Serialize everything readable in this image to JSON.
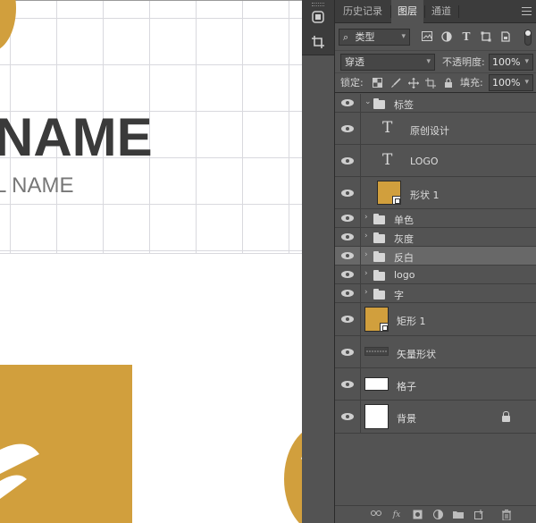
{
  "canvas": {
    "big_name": "NAME",
    "sub_name": "L NAME"
  },
  "panel": {
    "tabs": [
      {
        "label": "历史记录",
        "active": false
      },
      {
        "label": "图层",
        "active": true
      },
      {
        "label": "通道",
        "active": false
      }
    ],
    "filter": {
      "kind_label": "类型"
    },
    "blend": {
      "mode": "穿透",
      "opacity_label": "不透明度:",
      "opacity_value": "100%"
    },
    "lock": {
      "label": "锁定:",
      "fill_label": "填充:",
      "fill_value": "100%"
    },
    "layers": [
      {
        "name": "标签",
        "kind": "group",
        "expanded": true,
        "selected": false
      },
      {
        "name": "原创设计",
        "kind": "text",
        "selected": false
      },
      {
        "name": "LOGO",
        "kind": "text",
        "selected": false
      },
      {
        "name": "形状 1",
        "kind": "shape",
        "thumb_color": "#d19f3d",
        "selected": false
      },
      {
        "name": "单色",
        "kind": "group",
        "expanded": false,
        "selected": false
      },
      {
        "name": "灰度",
        "kind": "group",
        "expanded": false,
        "selected": false
      },
      {
        "name": "反白",
        "kind": "group",
        "expanded": false,
        "selected": true
      },
      {
        "name": "logo",
        "kind": "group",
        "expanded": false,
        "selected": false
      },
      {
        "name": "字",
        "kind": "group",
        "expanded": false,
        "selected": false
      },
      {
        "name": "矩形 1",
        "kind": "shape",
        "thumb_color": "#d19f3d",
        "selected": false
      },
      {
        "name": "矢量形状",
        "kind": "vector",
        "selected": false
      },
      {
        "name": "格子",
        "kind": "pixel",
        "thumb_color": "#ffffff",
        "selected": false
      },
      {
        "name": "背景",
        "kind": "background",
        "thumb_color": "#ffffff",
        "locked": true,
        "selected": false
      }
    ]
  },
  "colors": {
    "accent_gold": "#d19f3d",
    "panel_bg": "#535353",
    "selected_row": "#686868"
  }
}
